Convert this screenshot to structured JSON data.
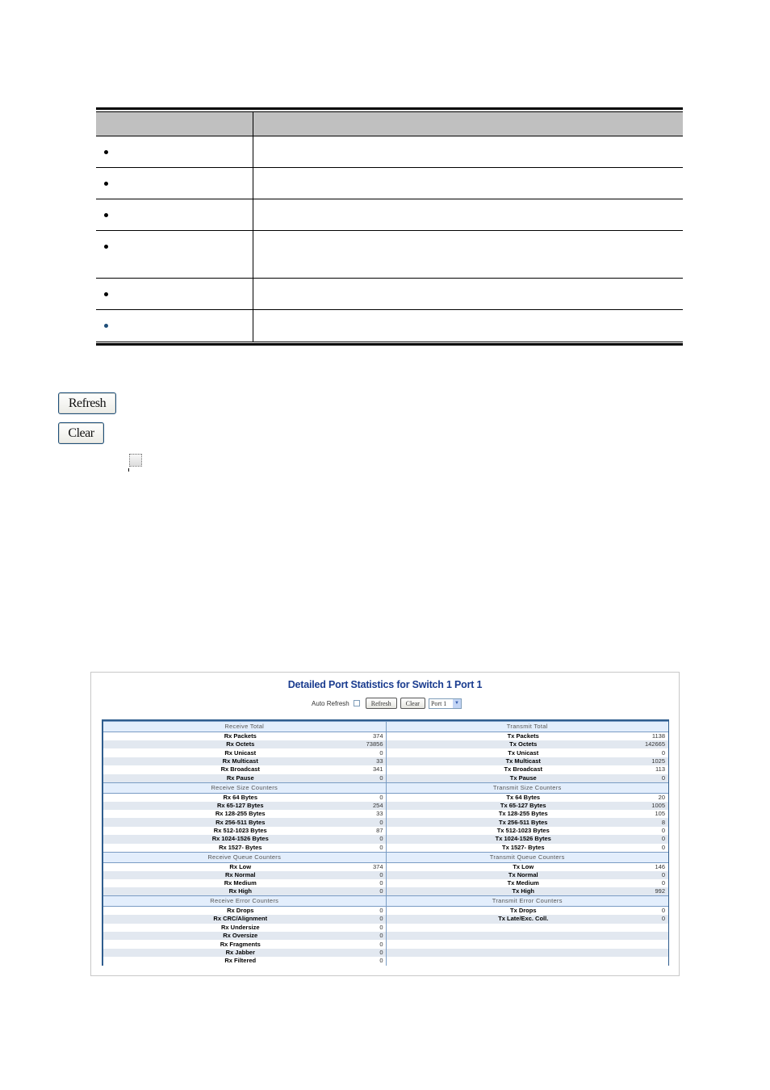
{
  "description_table": {
    "header": {
      "object": "",
      "description": ""
    },
    "rows": [
      {
        "bullet": "black",
        "object": "",
        "description": ""
      },
      {
        "bullet": "black",
        "object": "",
        "description": ""
      },
      {
        "bullet": "black",
        "object": "",
        "description": ""
      },
      {
        "bullet": "black",
        "object": "",
        "description": "",
        "tall": true
      },
      {
        "bullet": "black",
        "object": "",
        "description": ""
      },
      {
        "bullet": "blue",
        "object": "",
        "description": ""
      }
    ]
  },
  "buttons": {
    "refresh_label": "Refresh",
    "clear_label": "Clear"
  },
  "auto_refresh_checkbox": {
    "checked": false
  },
  "screenshot": {
    "title": "Detailed Port Statistics for Switch 1 Port 1",
    "controls": {
      "auto_refresh_label": "Auto Refresh",
      "auto_refresh_checked": false,
      "refresh_label": "Refresh",
      "clear_label": "Clear",
      "port_select_value": "Port 1",
      "select_arrow": "▼"
    },
    "sections": [
      {
        "left_title": "Receive Total",
        "right_title": "Transmit Total",
        "rows": [
          {
            "left_label": "Rx Packets",
            "left_value": "374",
            "right_label": "Tx Packets",
            "right_value": "1138"
          },
          {
            "left_label": "Rx Octets",
            "left_value": "73856",
            "right_label": "Tx Octets",
            "right_value": "142665"
          },
          {
            "left_label": "Rx Unicast",
            "left_value": "0",
            "right_label": "Tx Unicast",
            "right_value": "0"
          },
          {
            "left_label": "Rx Multicast",
            "left_value": "33",
            "right_label": "Tx Multicast",
            "right_value": "1025"
          },
          {
            "left_label": "Rx Broadcast",
            "left_value": "341",
            "right_label": "Tx Broadcast",
            "right_value": "113"
          },
          {
            "left_label": "Rx Pause",
            "left_value": "0",
            "right_label": "Tx Pause",
            "right_value": "0"
          }
        ]
      },
      {
        "left_title": "Receive Size Counters",
        "right_title": "Transmit Size Counters",
        "rows": [
          {
            "left_label": "Rx 64 Bytes",
            "left_value": "0",
            "right_label": "Tx 64 Bytes",
            "right_value": "20"
          },
          {
            "left_label": "Rx 65-127 Bytes",
            "left_value": "254",
            "right_label": "Tx 65-127 Bytes",
            "right_value": "1005"
          },
          {
            "left_label": "Rx 128-255 Bytes",
            "left_value": "33",
            "right_label": "Tx 128-255 Bytes",
            "right_value": "105"
          },
          {
            "left_label": "Rx 256-511 Bytes",
            "left_value": "0",
            "right_label": "Tx 256-511 Bytes",
            "right_value": "8"
          },
          {
            "left_label": "Rx 512-1023 Bytes",
            "left_value": "87",
            "right_label": "Tx 512-1023 Bytes",
            "right_value": "0"
          },
          {
            "left_label": "Rx 1024-1526 Bytes",
            "left_value": "0",
            "right_label": "Tx 1024-1526 Bytes",
            "right_value": "0"
          },
          {
            "left_label": "Rx 1527- Bytes",
            "left_value": "0",
            "right_label": "Tx 1527- Bytes",
            "right_value": "0"
          }
        ]
      },
      {
        "left_title": "Receive Queue Counters",
        "right_title": "Transmit Queue Counters",
        "rows": [
          {
            "left_label": "Rx Low",
            "left_value": "374",
            "right_label": "Tx Low",
            "right_value": "146"
          },
          {
            "left_label": "Rx Normal",
            "left_value": "0",
            "right_label": "Tx Normal",
            "right_value": "0"
          },
          {
            "left_label": "Rx Medium",
            "left_value": "0",
            "right_label": "Tx Medium",
            "right_value": "0"
          },
          {
            "left_label": "Rx High",
            "left_value": "0",
            "right_label": "Tx High",
            "right_value": "992"
          }
        ]
      },
      {
        "left_title": "Receive Error Counters",
        "right_title": "Transmit Error Counters",
        "rows": [
          {
            "left_label": "Rx Drops",
            "left_value": "0",
            "right_label": "Tx Drops",
            "right_value": "0"
          },
          {
            "left_label": "Rx CRC/Alignment",
            "left_value": "0",
            "right_label": "Tx Late/Exc. Coll.",
            "right_value": "0"
          },
          {
            "left_label": "Rx Undersize",
            "left_value": "0",
            "right_label": "",
            "right_value": ""
          },
          {
            "left_label": "Rx Oversize",
            "left_value": "0",
            "right_label": "",
            "right_value": ""
          },
          {
            "left_label": "Rx Fragments",
            "left_value": "0",
            "right_label": "",
            "right_value": ""
          },
          {
            "left_label": "Rx Jabber",
            "left_value": "0",
            "right_label": "",
            "right_value": ""
          },
          {
            "left_label": "Rx Filtered",
            "left_value": "0",
            "right_label": "",
            "right_value": ""
          }
        ]
      }
    ]
  }
}
